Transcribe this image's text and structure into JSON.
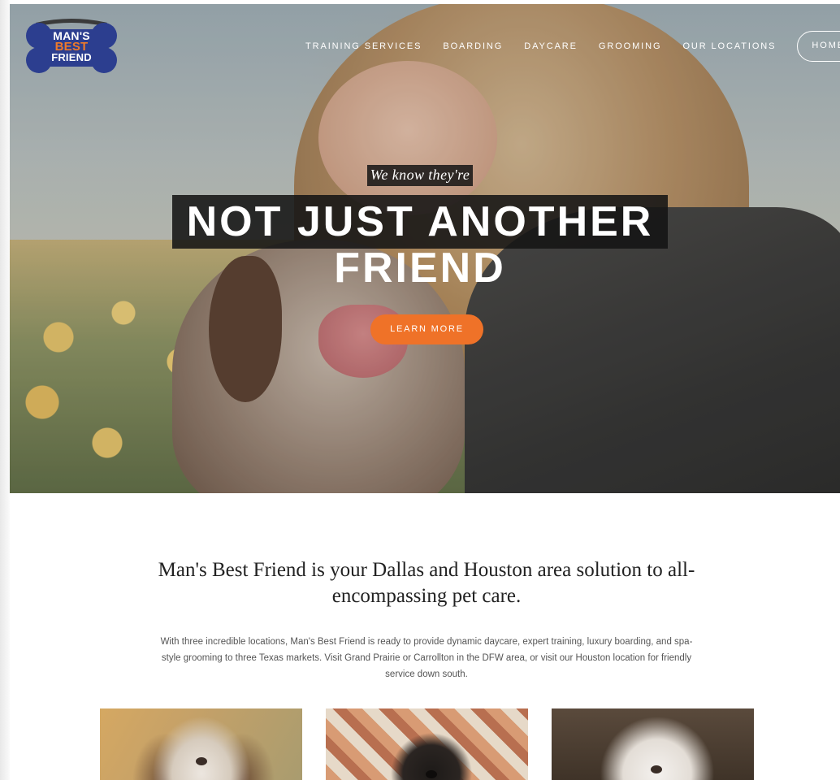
{
  "logo": {
    "line1": "MAN'S",
    "line2": "BEST",
    "line3": "FRIEND"
  },
  "nav": {
    "items": [
      {
        "label": "TRAINING SERVICES"
      },
      {
        "label": "BOARDING"
      },
      {
        "label": "DAYCARE"
      },
      {
        "label": "GROOMING"
      },
      {
        "label": "OUR LOCATIONS"
      }
    ],
    "home_label": "HOME"
  },
  "hero": {
    "kicker": "We know they're",
    "title_line1": "NOT JUST ANOTHER",
    "title_line2": "FRIEND",
    "cta_label": "LEARN MORE"
  },
  "intro": {
    "heading": "Man's Best Friend is your Dallas and Houston area solution to all-encompassing pet care.",
    "body": "With three incredible locations, Man's Best Friend is ready to provide dynamic daycare, expert training, luxury boarding, and spa-style grooming to three Texas markets. Visit Grand Prairie or Carrollton in the DFW area, or visit our Houston location for friendly service down south."
  },
  "colors": {
    "accent": "#ef7228",
    "logo_blue": "#2c3e8f",
    "text_dark": "#222222",
    "text_body": "#555555"
  }
}
